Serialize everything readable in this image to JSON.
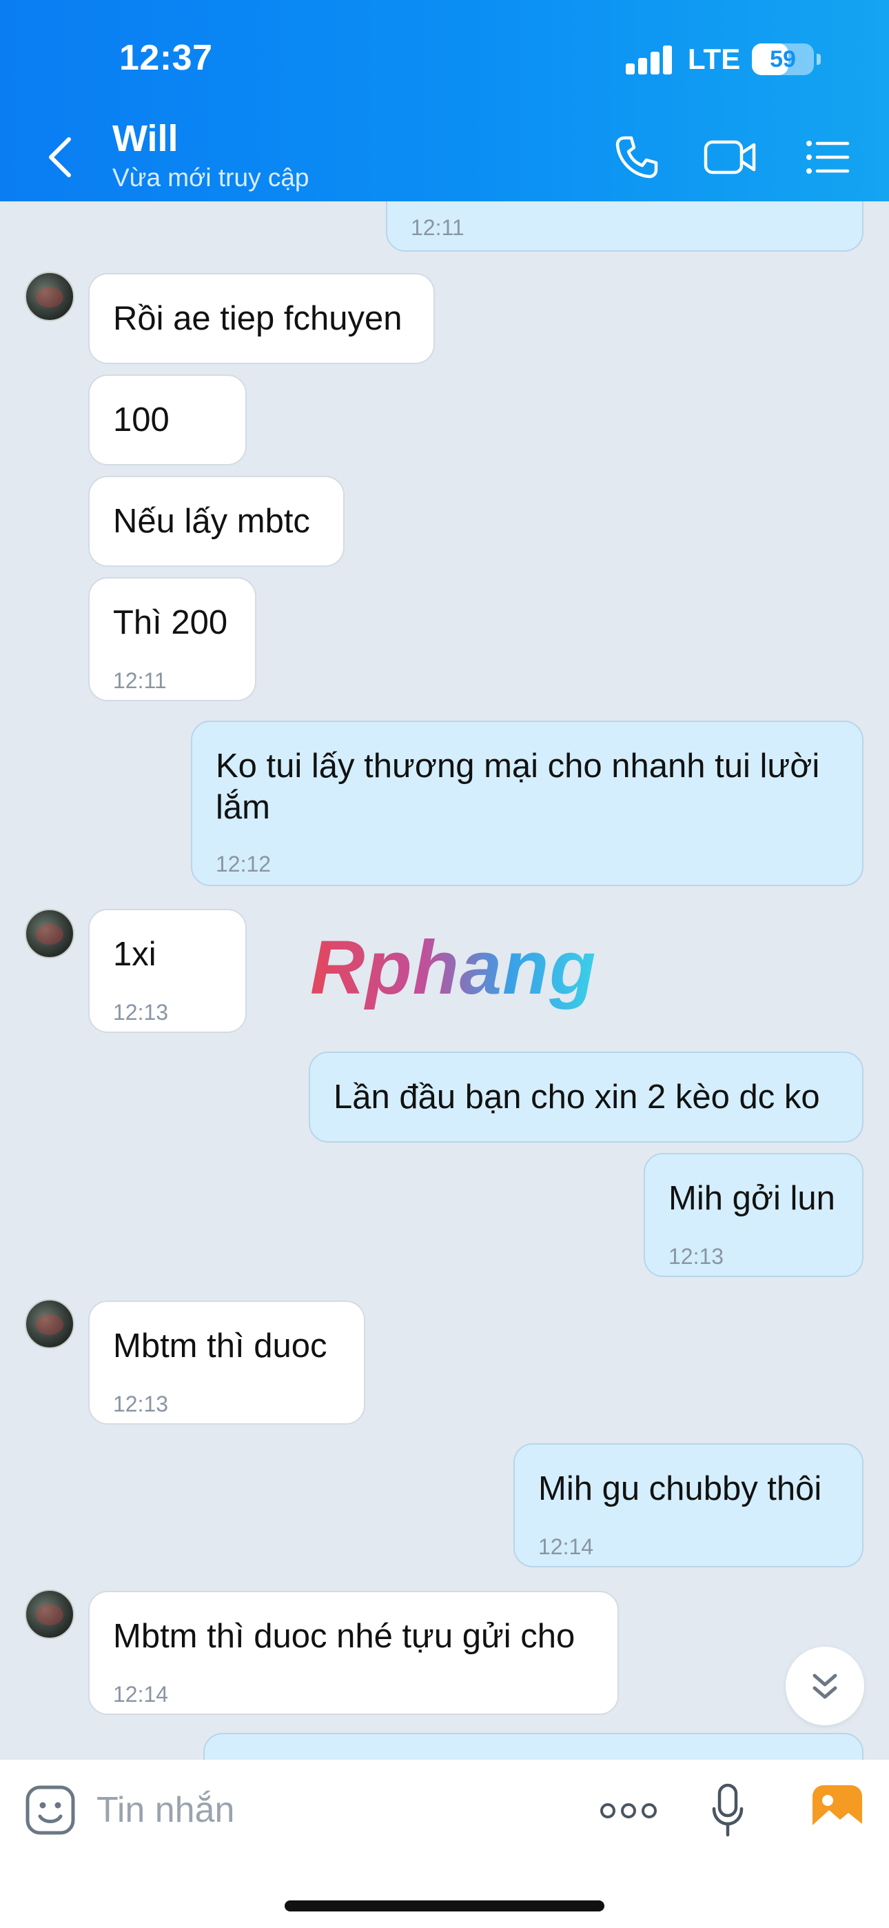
{
  "status_bar": {
    "time": "12:37",
    "network": "LTE",
    "battery": "59",
    "battery_level": 0.59
  },
  "header": {
    "contact_name": "Will",
    "contact_status": "Vừa mới truy cập"
  },
  "watermark": "Rphang",
  "messages": [
    {
      "dir": "out",
      "text": "",
      "time": "12:11"
    },
    {
      "dir": "in",
      "text": "Rồi ae tiep fchuyen",
      "time": ""
    },
    {
      "dir": "in",
      "text": "100",
      "time": ""
    },
    {
      "dir": "in",
      "text": "Nếu lấy mbtc",
      "time": ""
    },
    {
      "dir": "in",
      "text": "Thì 200",
      "time": "12:11"
    },
    {
      "dir": "out",
      "text": "Ko tui lấy thương mại cho nhanh tui lười\nlắm",
      "time": "12:12"
    },
    {
      "dir": "in",
      "text": "1xi",
      "time": "12:13"
    },
    {
      "dir": "out",
      "text": "Lần đầu bạn cho xin 2 kèo dc ko",
      "time": ""
    },
    {
      "dir": "out",
      "text": "Mih gởi lun",
      "time": "12:13"
    },
    {
      "dir": "in",
      "text": "Mbtm thì duoc",
      "time": "12:13"
    },
    {
      "dir": "out",
      "text": "Mih gu chubby thôi",
      "time": "12:14"
    },
    {
      "dir": "in",
      "text": "Mbtm thì duoc nhé tựu gửi cho",
      "time": "12:14"
    },
    {
      "dir": "out",
      "text": "",
      "time": ""
    }
  ],
  "composer": {
    "placeholder": "Tin nhắn"
  },
  "icons": {
    "back": "back-chevron-icon",
    "call": "phone-icon",
    "video": "video-camera-icon",
    "menu": "list-menu-icon",
    "sticker": "sticker-face-icon",
    "more": "more-dots-icon",
    "mic": "microphone-icon",
    "gallery": "gallery-icon",
    "scroll": "scroll-down-icon"
  },
  "colors": {
    "header": "#0b8ff4",
    "outgoing_bubble": "#d4eefd",
    "incoming_bubble": "#ffffff",
    "background": "#e2e9f1",
    "gallery_icon": "#f59a23"
  }
}
